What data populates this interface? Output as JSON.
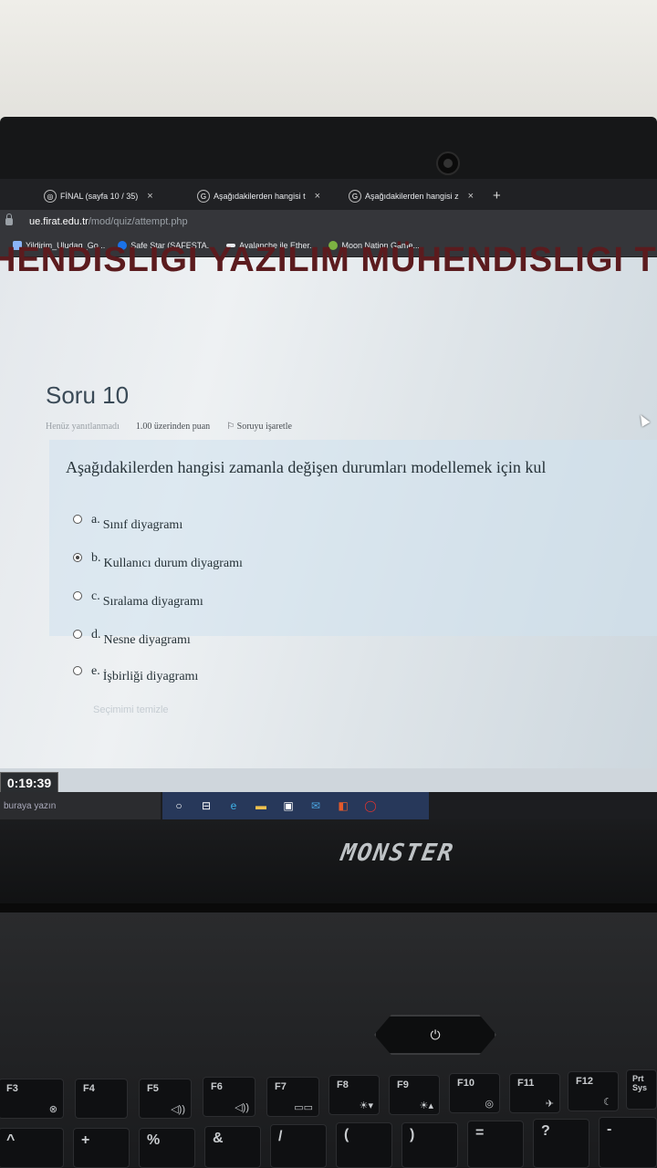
{
  "browser": {
    "tabs": [
      {
        "title": "FİNAL (sayfa 10 / 35)",
        "close": "×"
      },
      {
        "title": "Aşağıdakilerden hangisi t",
        "close": "×"
      },
      {
        "title": "Aşağıdakilerden hangisi z",
        "close": "×"
      }
    ],
    "new_tab": "+",
    "url_host": "ue.firat.edu.tr",
    "url_path": "/mod/quiz/attempt.php",
    "bookmarks": [
      {
        "label": "Yildirim_Uludag_Go...",
        "color": "#8ab4f8"
      },
      {
        "label": "Safe Star (SAFESTA...",
        "color": "#1a73e8"
      },
      {
        "label": "Avalanche ile Ether...",
        "color": "#e8eaed"
      },
      {
        "label": "Moon Nation Game...",
        "color": "#7cb342"
      }
    ]
  },
  "page": {
    "banner": "HENDISLIGI YAZILIM MÜHENDISLIGI TEKNOL",
    "question_title": "Soru 10",
    "status": "Henüz yanıtlanmadı",
    "points": "1.00 üzerinden puan",
    "flag": "Soruyu işaretle",
    "question_text": "Aşağıdakilerden hangisi zamanla değişen durumları modellemek için kul",
    "options": [
      {
        "letter": "a.",
        "label": "Sınıf diyagramı",
        "selected": false
      },
      {
        "letter": "b.",
        "label": "Kullanıcı durum diyagramı",
        "selected": true
      },
      {
        "letter": "c.",
        "label": "Sıralama diyagramı",
        "selected": false
      },
      {
        "letter": "d.",
        "label": "Nesne diyagramı",
        "selected": false
      },
      {
        "letter": "e.",
        "label": "İşbirliği diyagramı",
        "selected": false
      }
    ],
    "clear_choice": "Seçimimi temizle"
  },
  "timer": "0:19:39",
  "taskbar": {
    "search_placeholder": "buraya yazın",
    "icons": [
      "windows-search-icon",
      "task-view-icon",
      "edge-icon",
      "file-explorer-icon",
      "store-icon",
      "mail-icon",
      "office-icon",
      "opera-icon"
    ]
  },
  "laptop": {
    "brand": "MONSTER",
    "power_symbol": "⏻",
    "keys": [
      {
        "main": "F3",
        "sub": "⊗"
      },
      {
        "main": "F4",
        "sub": ""
      },
      {
        "main": "F5",
        "sub": "◁))"
      },
      {
        "main": "F6",
        "sub": "◁))"
      },
      {
        "main": "F7",
        "sub": "▭▭"
      },
      {
        "main": "F8",
        "sub": "☀▾"
      },
      {
        "main": "F9",
        "sub": "☀▴"
      },
      {
        "main": "F10",
        "sub": "◎"
      },
      {
        "main": "F11",
        "sub": "✈"
      },
      {
        "main": "F12",
        "sub": "☾"
      },
      {
        "main": "Prt Sys",
        "sub": ""
      }
    ],
    "bottom_keys": [
      "^",
      "+",
      "%",
      "&",
      "/",
      "(",
      ")",
      "=",
      "?",
      "-"
    ]
  }
}
